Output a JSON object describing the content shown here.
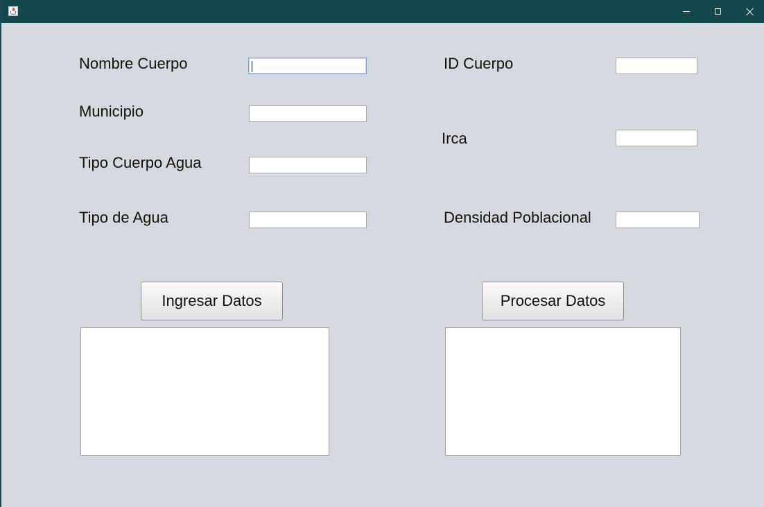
{
  "window": {
    "title": "",
    "controls": [
      "minimize-icon",
      "maximize-icon",
      "close-icon"
    ]
  },
  "form": {
    "nombre_cuerpo": {
      "label": "Nombre Cuerpo",
      "value": ""
    },
    "municipio": {
      "label": "Municipio",
      "value": ""
    },
    "tipo_cuerpo_agua": {
      "label": "Tipo Cuerpo Agua",
      "value": ""
    },
    "tipo_de_agua": {
      "label": "Tipo de Agua",
      "value": ""
    },
    "id_cuerpo": {
      "label": "ID Cuerpo",
      "value": ""
    },
    "irca": {
      "label": "Irca",
      "value": ""
    },
    "densidad_poblacional": {
      "label": "Densidad Poblacional",
      "value": ""
    }
  },
  "actions": {
    "ingresar_label": "Ingresar Datos",
    "procesar_label": "Procesar Datos"
  },
  "output": {
    "ingresar_text": "",
    "procesar_text": ""
  },
  "colors": {
    "titlebar": "#13484c",
    "background": "#d6d9df",
    "focus_border": "#7a9cc6"
  }
}
